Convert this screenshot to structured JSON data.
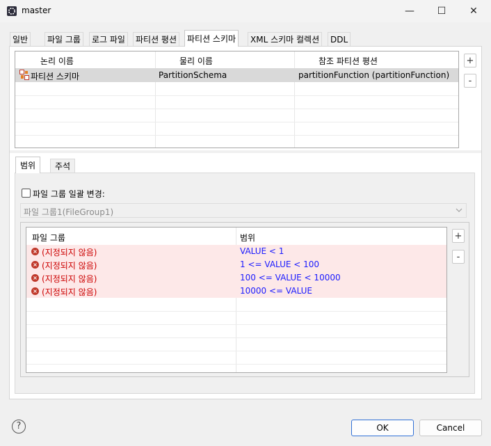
{
  "window": {
    "title": "master",
    "minimize_glyph": "—",
    "maximize_glyph": "☐",
    "close_glyph": "✕"
  },
  "tabs": [
    {
      "label": "일반"
    },
    {
      "label": "파일 그룹"
    },
    {
      "label": "로그 파일"
    },
    {
      "label": "파티션 평션"
    },
    {
      "label": "파티션 스키마"
    },
    {
      "label": "XML 스키마 컬렉션"
    },
    {
      "label": "DDL"
    }
  ],
  "active_tab": "파티션 스키마",
  "schema_table": {
    "headers": [
      "논리 이름",
      "물리 이름",
      "참조 파티션 평션"
    ],
    "rows": [
      {
        "logical": "파티션 스키마",
        "physical": "PartitionSchema",
        "function": "partitionFunction (partitionFunction)"
      }
    ],
    "add_label": "+",
    "remove_label": "-"
  },
  "subtabs": [
    {
      "label": "범위"
    },
    {
      "label": "주석"
    }
  ],
  "bulk_change": {
    "label": "파일 그룹 일괄 변경:",
    "checked": false
  },
  "filegroup_select": {
    "value": "파일 그룹1(FileGroup1)"
  },
  "range_table": {
    "headers": [
      "파일 그룹",
      "범위"
    ],
    "rows": [
      {
        "filegroup": "(지정되지 않음)",
        "range": "VALUE < 1"
      },
      {
        "filegroup": "(지정되지 않음)",
        "range": "1 <= VALUE < 100"
      },
      {
        "filegroup": "(지정되지 않음)",
        "range": "100 <= VALUE < 10000"
      },
      {
        "filegroup": "(지정되지 않음)",
        "range": "10000 <= VALUE"
      }
    ],
    "add_label": "+",
    "remove_label": "-"
  },
  "footer": {
    "help_glyph": "?",
    "ok_label": "OK",
    "cancel_label": "Cancel"
  },
  "colors": {
    "error_row": "#fde8e8",
    "error_text": "#cc0000",
    "range_text": "#1a1aff",
    "selected_row": "#d9d9d9",
    "ok_border": "#2f6fd6"
  }
}
